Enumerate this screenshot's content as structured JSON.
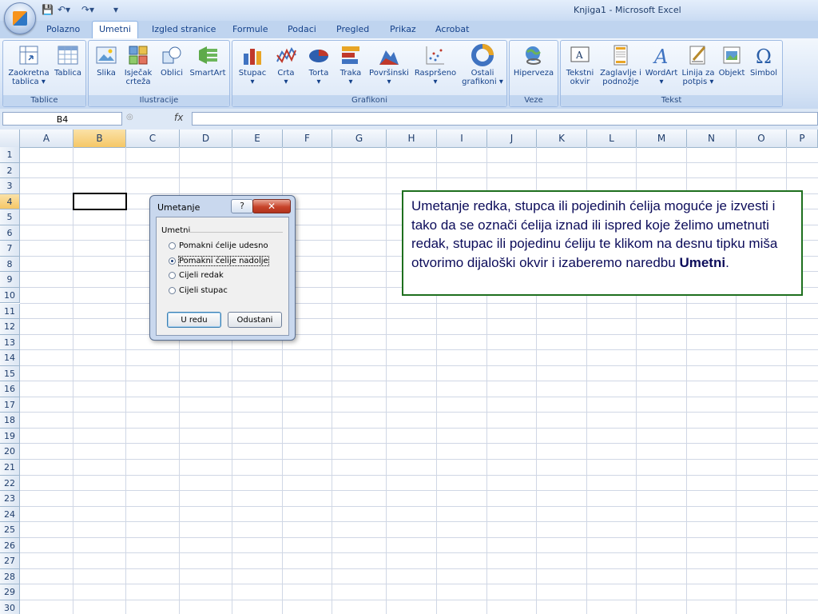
{
  "window": {
    "title": "Knjiga1 - Microsoft Excel"
  },
  "tabs": [
    "Polazno",
    "Umetni",
    "Izgled stranice",
    "Formule",
    "Podaci",
    "Pregled",
    "Prikaz",
    "Acrobat"
  ],
  "active_tab": "Umetni",
  "ribbon": {
    "groups": [
      {
        "label": "Tablice",
        "buttons": [
          {
            "line1": "Zaokretna",
            "line2": "tablica ▾"
          },
          {
            "line1": "Tablica",
            "line2": ""
          }
        ]
      },
      {
        "label": "Ilustracije",
        "buttons": [
          {
            "line1": "Slika",
            "line2": ""
          },
          {
            "line1": "Isječak",
            "line2": "crteža"
          },
          {
            "line1": "Oblici",
            "line2": ""
          },
          {
            "line1": "SmartArt",
            "line2": ""
          }
        ]
      },
      {
        "label": "Grafikoni",
        "buttons": [
          {
            "line1": "Stupac",
            "line2": "▾"
          },
          {
            "line1": "Crta",
            "line2": "▾"
          },
          {
            "line1": "Torta",
            "line2": "▾"
          },
          {
            "line1": "Traka",
            "line2": "▾"
          },
          {
            "line1": "Površinski",
            "line2": "▾"
          },
          {
            "line1": "Raspršeno",
            "line2": "▾"
          },
          {
            "line1": "Ostali",
            "line2": "grafikoni ▾"
          }
        ]
      },
      {
        "label": "Veze",
        "buttons": [
          {
            "line1": "Hiperveza",
            "line2": ""
          }
        ]
      },
      {
        "label": "Tekst",
        "buttons": [
          {
            "line1": "Tekstni",
            "line2": "okvir"
          },
          {
            "line1": "Zaglavlje i",
            "line2": "podnožje"
          },
          {
            "line1": "WordArt",
            "line2": "▾"
          },
          {
            "line1": "Linija za",
            "line2": "potpis ▾"
          },
          {
            "line1": "Objekt",
            "line2": ""
          },
          {
            "line1": "Simbol",
            "line2": ""
          }
        ]
      }
    ]
  },
  "formula_bar": {
    "name_box": "B4",
    "fx": "fx",
    "content": ""
  },
  "columns": [
    "A",
    "B",
    "C",
    "D",
    "E",
    "F",
    "G",
    "H",
    "I",
    "J",
    "K",
    "L",
    "M",
    "N",
    "O",
    "P"
  ],
  "rows": [
    "1",
    "2",
    "3",
    "4",
    "5",
    "6",
    "7",
    "8",
    "9",
    "10",
    "11",
    "12",
    "13",
    "14",
    "15",
    "16",
    "17",
    "18",
    "19",
    "20",
    "21",
    "22",
    "23",
    "24",
    "25",
    "26",
    "27",
    "28",
    "29",
    "30"
  ],
  "selected_cell": {
    "column": "B",
    "row": "4"
  },
  "dialog": {
    "title": "Umetanje",
    "help": "?",
    "close": "✕",
    "group_label": "Umetni",
    "options": [
      {
        "label": "Pomakni ćelije udesno",
        "selected": false
      },
      {
        "label": "Pomakni ćelije nadolje",
        "selected": true
      },
      {
        "label": "Cijeli redak",
        "selected": false
      },
      {
        "label": "Cijeli stupac",
        "selected": false
      }
    ],
    "ok": "U redu",
    "cancel": "Odustani"
  },
  "note": {
    "text": "Umetanje redka, stupca ili pojedinih ćelija moguće je izvesti i tako da se označi ćelija iznad ili ispred koje želimo umetnuti redak, stupac ili pojedinu ćeliju te klikom na desnu tipku miša otvorimo dijaloški okvir i izaberemo naredbu ",
    "bold": "Umetni",
    "end": "."
  },
  "colors": {
    "note_border": "#1e6f1e",
    "selection_header": "#f5c767",
    "ribbon_bg": "#d8e5f6"
  }
}
